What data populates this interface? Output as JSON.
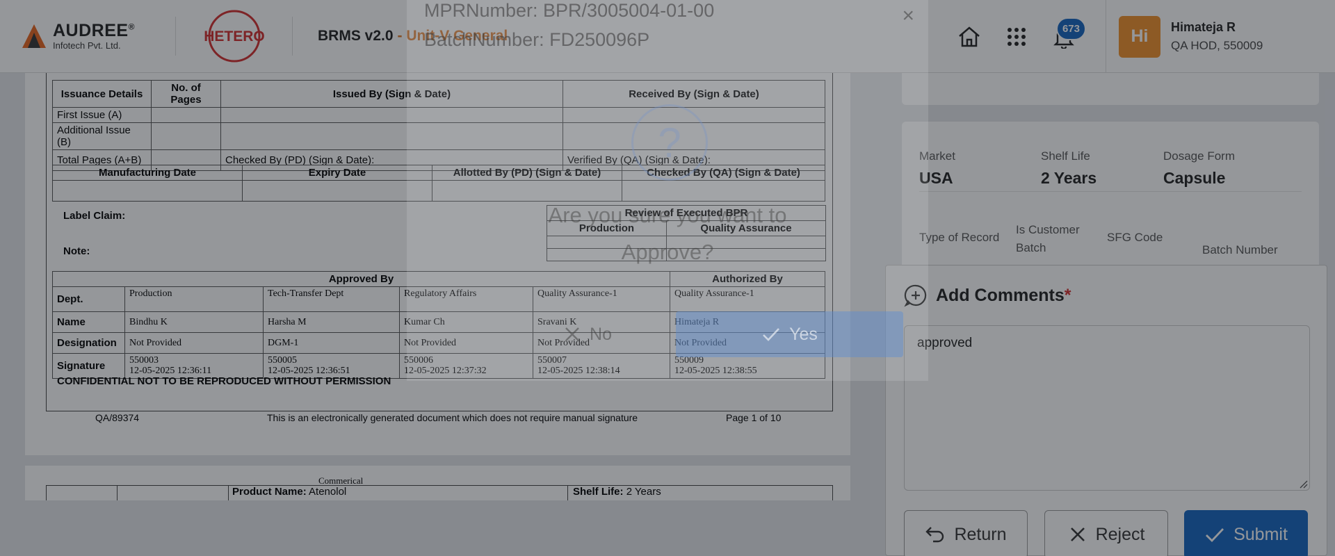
{
  "header": {
    "brand_name": "AUDREE",
    "brand_reg": "®",
    "brand_sub": "Infotech Pvt. Ltd.",
    "client_logo_text": "HETERO",
    "app_title": "BRMS v2.0",
    "app_unit": "- Unit-V General",
    "notification_count": "673",
    "user": {
      "initials": "Hi",
      "name": "Himateja R",
      "role": "QA HOD, 550009"
    }
  },
  "document": {
    "issuance": {
      "headers": [
        "Issuance Details",
        "No. of Pages",
        "Issued By (Sign & Date)",
        "Received By (Sign & Date)"
      ],
      "rows": [
        "First Issue (A)",
        "Additional Issue (B)",
        "Total Pages (A+B)"
      ],
      "checked_by": "Checked By (PD) (Sign & Date):",
      "verified_by": "Verified By (QA) (Sign & Date):"
    },
    "dates_headers": [
      "Manufacturing Date",
      "Expiry Date",
      "Allotted By (PD) (Sign & Date)",
      "Checked By (QA) (Sign & Date)"
    ],
    "label_claim": "Label Claim:",
    "note": "Note:",
    "review": {
      "title": "Review of Executed BPR",
      "cols": [
        "Production",
        "Quality Assurance"
      ]
    },
    "approval": {
      "approved_by": "Approved By",
      "authorized_by": "Authorized By",
      "row_labels": [
        "Dept.",
        "Name",
        "Designation",
        "Signature"
      ],
      "columns": [
        {
          "dept": "Production",
          "name": "Bindhu  K",
          "designation": "Not Provided",
          "sig_id": "550003",
          "sig_date": "12-05-2025 12:36:11"
        },
        {
          "dept": "Tech-Transfer Dept",
          "name": "Harsha  M",
          "designation": "DGM-1",
          "sig_id": "550005",
          "sig_date": "12-05-2025 12:36:51"
        },
        {
          "dept": "Regulatory Affairs",
          "name": "Kumar  Ch",
          "designation": "Not Provided",
          "sig_id": "550006",
          "sig_date": "12-05-2025 12:37:32"
        },
        {
          "dept": "Quality Assurance-1",
          "name": "Sravani  K",
          "designation": "Not Provided",
          "sig_id": "550007",
          "sig_date": "12-05-2025 12:38:14"
        },
        {
          "dept": "Quality Assurance-1",
          "name": "Himateja  R",
          "designation": "Not Provided",
          "sig_id": "550009",
          "sig_date": "12-05-2025 12:38:55"
        }
      ]
    },
    "confidential": "CONFIDENTIAL NOT TO BE REPRODUCED WITHOUT PERMISSION",
    "footer": {
      "doc_no": "QA/89374",
      "note": "This is an electronically generated document which does not require manual signature",
      "page": "Page 1 of 10"
    },
    "page2": {
      "commercial": "Commerical",
      "product_label": "Product Name:",
      "product_value": "Atenolol",
      "shelf_label": "Shelf Life:",
      "shelf_value": "2 Years"
    }
  },
  "info": {
    "market_label": "Market",
    "market_value": "USA",
    "shelf_label": "Shelf Life",
    "shelf_value": "2 Years",
    "dosage_label": "Dosage Form",
    "dosage_value": "Capsule",
    "type_label": "Type of Record",
    "customer_label_1": "Is Customer",
    "customer_label_2": "Batch",
    "sfg_label": "SFG Code",
    "batch_label": "Batch Number"
  },
  "comments": {
    "title": "Add Comments",
    "required_mark": "*",
    "value": "approved",
    "return_label": "Return",
    "reject_label": "Reject",
    "submit_label": "Submit"
  },
  "dialog": {
    "mpr_line": "MPRNumber: BPR/3005004-01-00",
    "batch_line": "BatchNumber: FD250096P",
    "close": "×",
    "question_mark": "?",
    "message_1": "Are you sure you want to",
    "message_2": "Approve?",
    "no_label": "No",
    "yes_label": "Yes"
  },
  "colors": {
    "accent": "#1565c0",
    "unit": "#e07a28",
    "avatar": "#f0902a",
    "hetero_red": "#d32f2f"
  }
}
